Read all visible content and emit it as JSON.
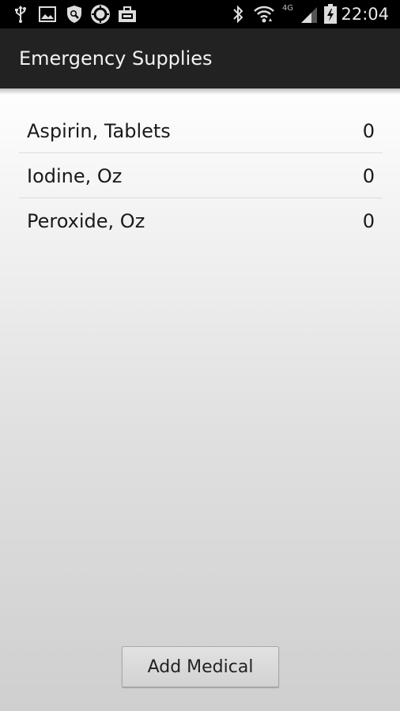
{
  "status_bar": {
    "time": "22:04",
    "network_label": "4G",
    "icons": [
      "usb-icon",
      "image-icon",
      "shield-icon",
      "sync-icon",
      "briefcase-icon",
      "bluetooth-icon",
      "wifi-icon",
      "signal-icon",
      "battery-icon"
    ]
  },
  "action_bar": {
    "title": "Emergency Supplies"
  },
  "supplies": [
    {
      "name": "Aspirin, Tablets",
      "quantity": "0"
    },
    {
      "name": "Iodine, Oz",
      "quantity": "0"
    },
    {
      "name": "Peroxide, Oz",
      "quantity": "0"
    }
  ],
  "footer": {
    "add_button_label": "Add Medical"
  }
}
